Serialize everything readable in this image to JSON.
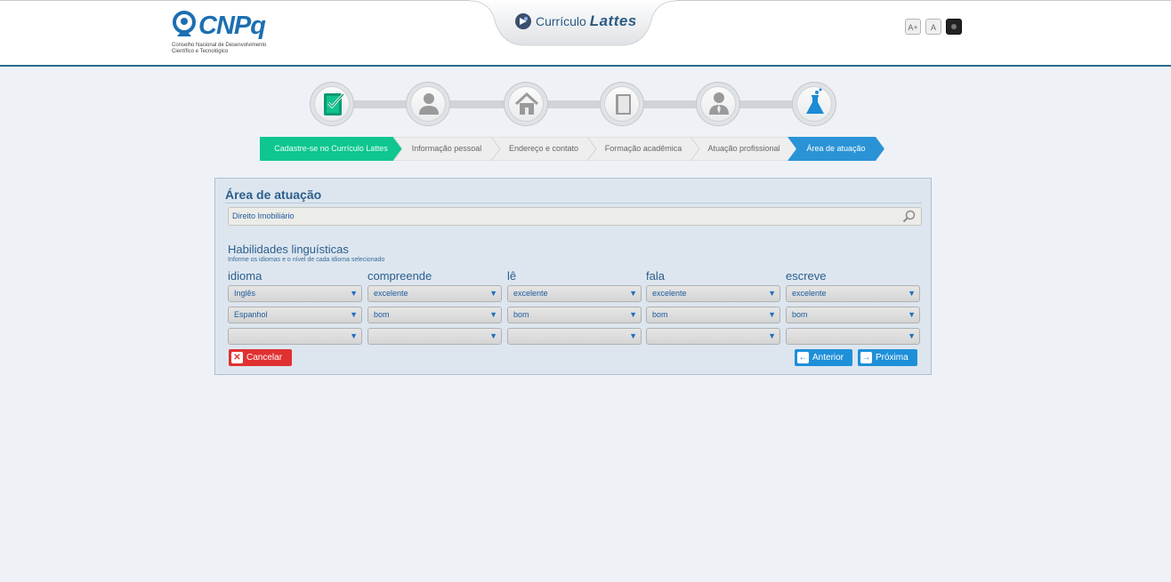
{
  "header": {
    "logo_text": "CNPq",
    "logo_subtitle_line1": "Conselho Nacional de Desenvolvimento",
    "logo_subtitle_line2": "Científico e Tecnológico",
    "app_title_prefix": "Currículo",
    "app_title_name": "Lattes",
    "accessibility": [
      "A+",
      "A",
      ""
    ]
  },
  "steps": [
    {
      "icon": "document-check-icon",
      "label": "Cadastre-se no Currículo Lattes",
      "state": "done"
    },
    {
      "icon": "person-icon",
      "label": "Informação pessoal",
      "state": "pending"
    },
    {
      "icon": "house-icon",
      "label": "Endereço e contato",
      "state": "pending"
    },
    {
      "icon": "book-icon",
      "label": "Formação acadêmica",
      "state": "pending"
    },
    {
      "icon": "professional-icon",
      "label": "Atuação profissional",
      "state": "pending"
    },
    {
      "icon": "flask-icon",
      "label": "Área de atuação",
      "state": "active"
    }
  ],
  "colors": {
    "done": "#0fc690",
    "active": "#2a93d6",
    "pending": "#eeeeee"
  },
  "panel": {
    "title": "Área de atuação",
    "search_value": "Direito Imobiliário",
    "languages": {
      "title": "Habilidades linguísticas",
      "subtitle": "Informe os idiomas e o nível de cada idioma selecionado",
      "columns": [
        "idioma",
        "compreende",
        "lê",
        "fala",
        "escreve"
      ],
      "rows": [
        [
          "Inglês",
          "excelente",
          "excelente",
          "excelente",
          "excelente"
        ],
        [
          "Espanhol",
          "bom",
          "bom",
          "bom",
          "bom"
        ],
        [
          "",
          "",
          "",
          "",
          ""
        ]
      ]
    },
    "buttons": {
      "cancel": "Cancelar",
      "previous": "Anterior",
      "next": "Próxima"
    }
  }
}
